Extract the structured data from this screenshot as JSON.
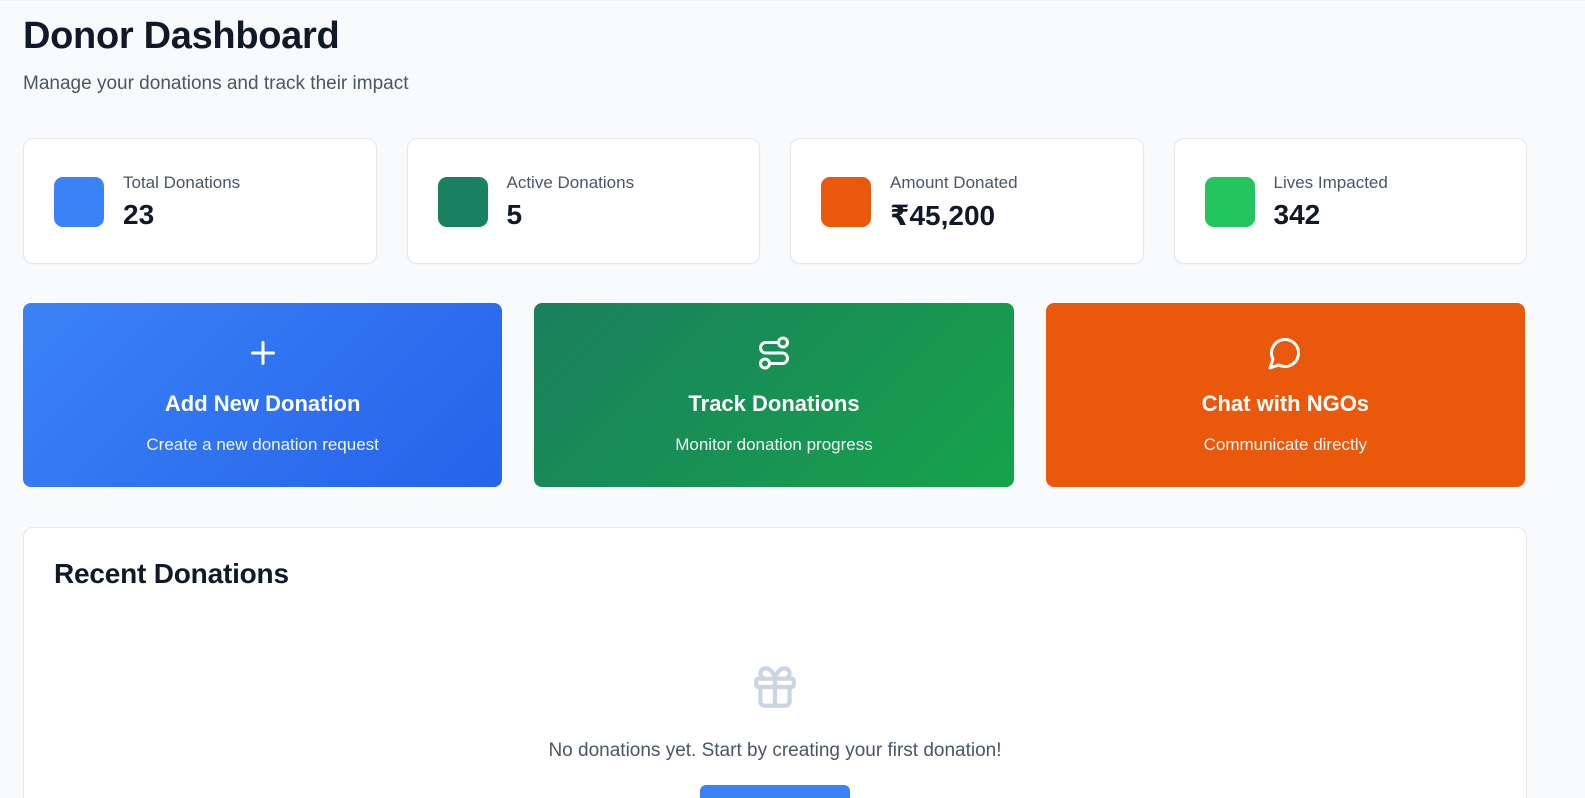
{
  "header": {
    "title": "Donor Dashboard",
    "subtitle": "Manage your donations and track their impact"
  },
  "stats": [
    {
      "label": "Total Donations",
      "value": "23",
      "color": "#3b82f6"
    },
    {
      "label": "Active Donations",
      "value": "5",
      "color": "#198160"
    },
    {
      "label": "Amount Donated",
      "value": "₹45,200",
      "color": "#ea580c"
    },
    {
      "label": "Lives Impacted",
      "value": "342",
      "color": "#22c55e"
    }
  ],
  "actions": [
    {
      "title": "Add New Donation",
      "desc": "Create a new donation request",
      "icon": "plus-icon"
    },
    {
      "title": "Track Donations",
      "desc": "Monitor donation progress",
      "icon": "route-icon"
    },
    {
      "title": "Chat with NGOs",
      "desc": "Communicate directly",
      "icon": "message-circle-icon"
    }
  ],
  "recent": {
    "title": "Recent Donations",
    "empty_text": "No donations yet. Start by creating your first donation!",
    "empty_icon": "gift-icon"
  }
}
